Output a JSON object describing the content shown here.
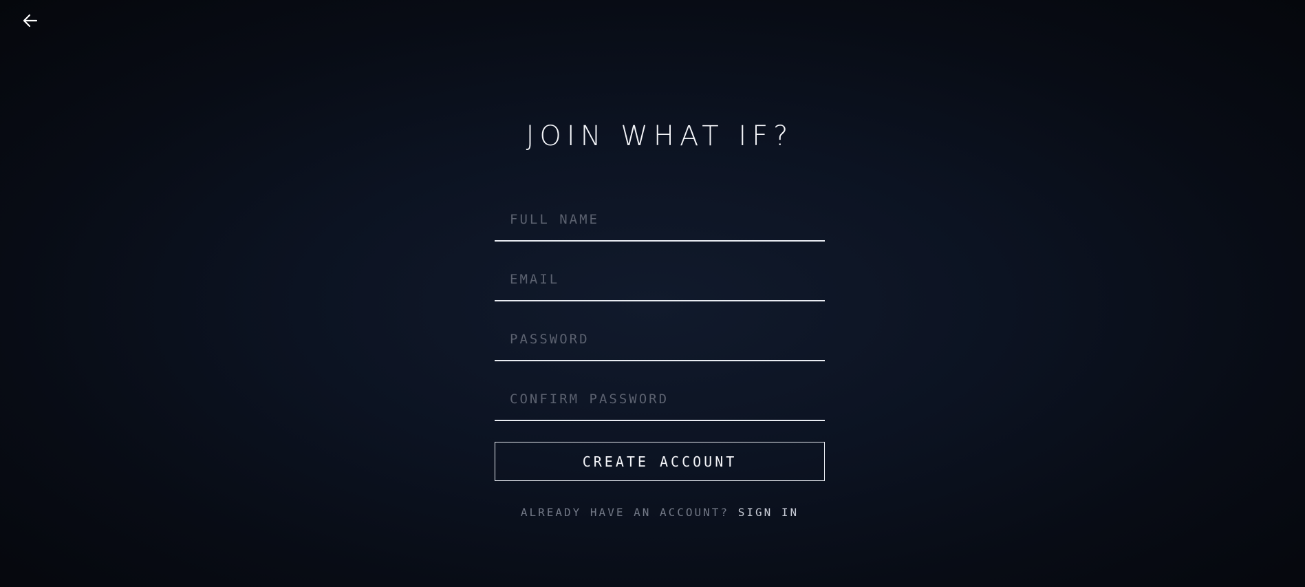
{
  "nav": {
    "back_icon": "arrow-left-icon"
  },
  "title": "JOIN WHAT IF?",
  "form": {
    "full_name": {
      "placeholder": "FULL NAME",
      "value": ""
    },
    "email": {
      "placeholder": "EMAIL",
      "value": ""
    },
    "password": {
      "placeholder": "PASSWORD",
      "value": ""
    },
    "confirm_password": {
      "placeholder": "CONFIRM PASSWORD",
      "value": ""
    },
    "submit_label": "CREATE ACCOUNT"
  },
  "footer": {
    "prompt": "ALREADY HAVE AN ACCOUNT? ",
    "link_label": "SIGN IN"
  },
  "colors": {
    "background": "#0c1322",
    "line": "#e9ecf2",
    "placeholder": "#5c6270",
    "text": "#ffffff"
  }
}
